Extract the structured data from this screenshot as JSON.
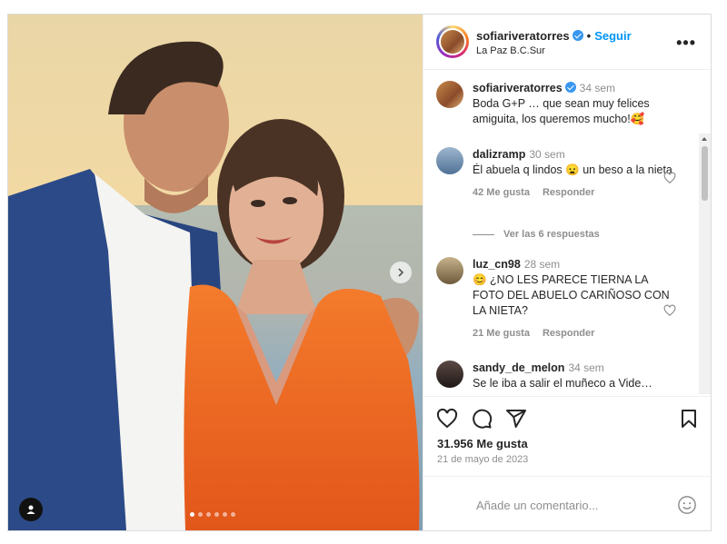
{
  "post": {
    "username": "sofiariveratorres",
    "follow_label": "Seguir",
    "separator": "•",
    "location": "La Paz B.C.Sur",
    "more_label": "•••",
    "carousel": {
      "dot_count": 6,
      "active_index": 0
    }
  },
  "comments": [
    {
      "username": "sofiariveratorres",
      "time": "34 sem",
      "text": "Boda G+P … que sean muy felices amiguita, los queremos mucho!🥰",
      "verified": true
    },
    {
      "username": "dalizramp",
      "time": "30 sem",
      "text": "Él abuela q lindos 😦 un beso a la nieta",
      "likes": "42 Me gusta",
      "reply": "Responder"
    },
    {
      "username": "luz_cn98",
      "time": "28 sem",
      "text": "😊 ¿NO LES PARECE TIERNA LA FOTO DEL ABUELO CARIÑOSO CON LA NIETA?",
      "likes": "21 Me gusta",
      "reply": "Responder"
    },
    {
      "username": "sandy_de_melon",
      "time": "34 sem",
      "text": "Se le iba a salir el muñeco a Vide…"
    }
  ],
  "view_replies": "Ver las 6 respuestas",
  "stats": {
    "likes": "31.956 Me gusta",
    "date": "21 de mayo de 2023"
  },
  "composer": {
    "placeholder": "Añade un comentario..."
  },
  "colors": {
    "accent": "#0095f6",
    "verified": "#3897f0",
    "dress": "#f06a1f",
    "suit": "#2c4a87"
  }
}
